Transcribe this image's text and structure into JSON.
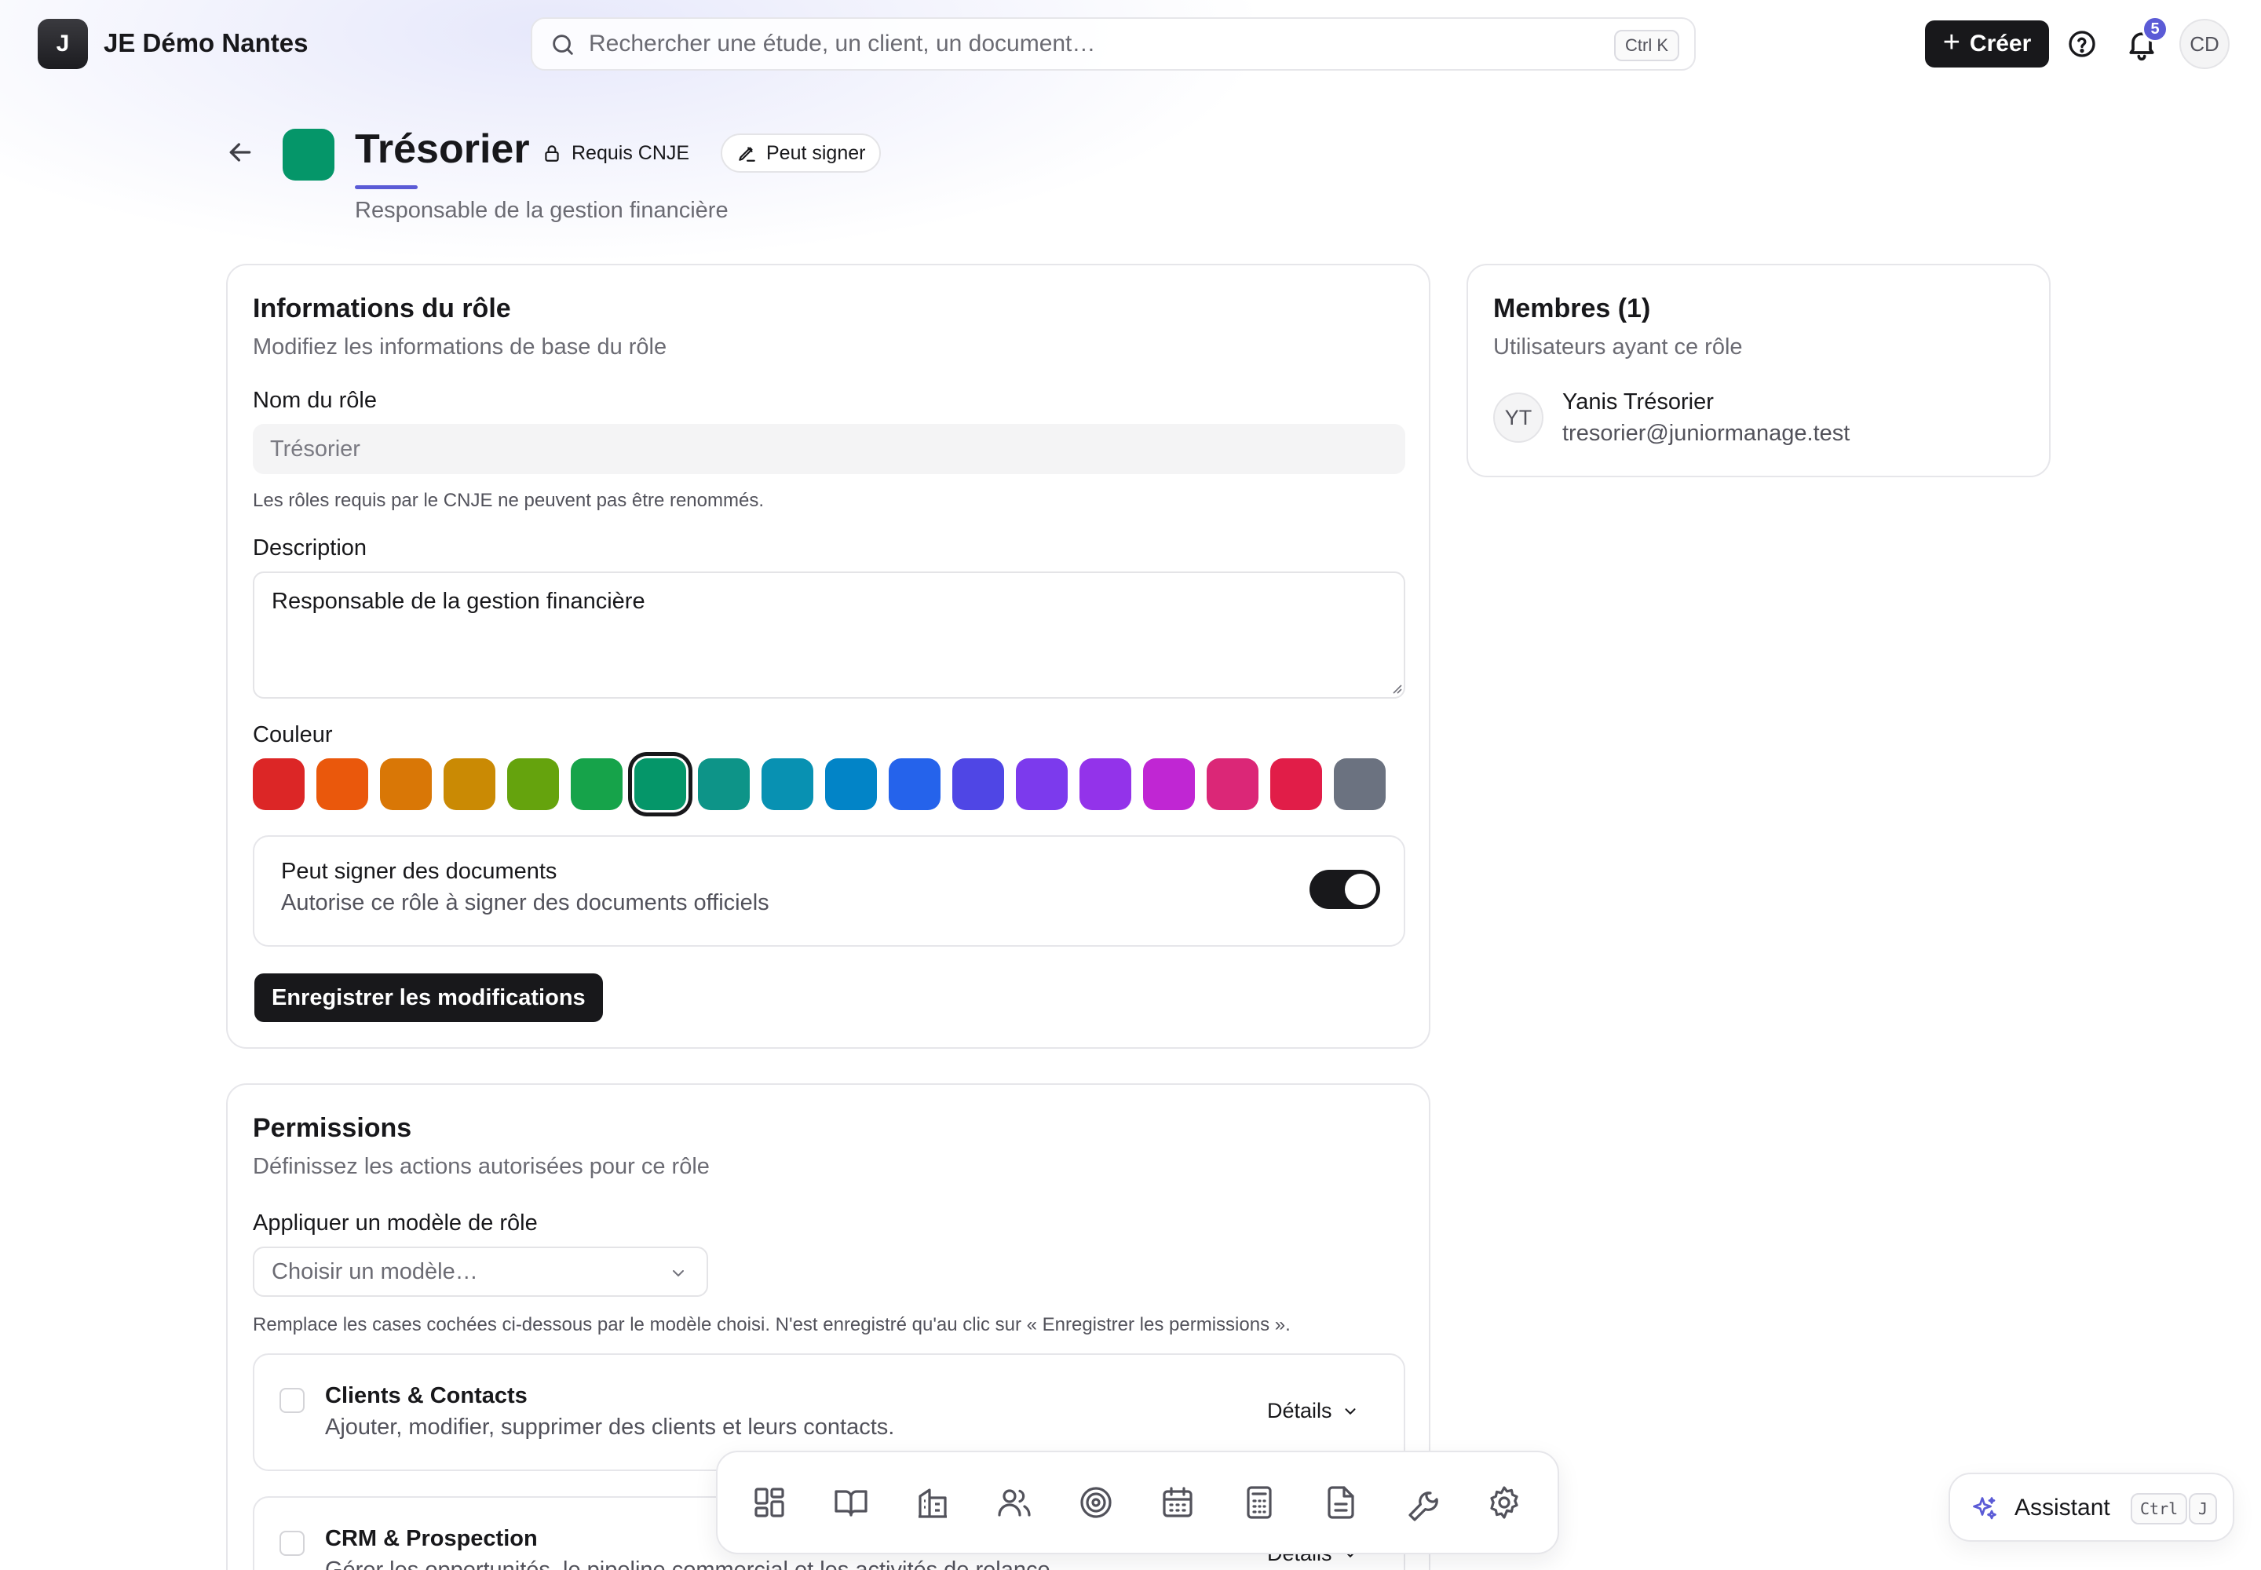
{
  "topbar": {
    "org_initial": "J",
    "org_name": "JE Démo Nantes",
    "search_placeholder": "Rechercher une étude, un client, un document…",
    "search_shortcut": "Ctrl K",
    "create_label": "Créer",
    "notifications_count": "5",
    "user_initials": "CD"
  },
  "header": {
    "title": "Trésorier",
    "subtitle": "Responsable de la gestion financière",
    "badge_required": "Requis CNJE",
    "badge_sign": "Peut signer",
    "role_color": "#059669"
  },
  "role_info": {
    "title": "Informations du rôle",
    "description": "Modifiez les informations de base du rôle",
    "name_label": "Nom du rôle",
    "name_value": "Trésorier",
    "name_help": "Les rôles requis par le CNJE ne peuvent pas être renommés.",
    "desc_label": "Description",
    "desc_value": "Responsable de la gestion financière",
    "color_label": "Couleur",
    "colors": [
      "#dc2626",
      "#ea580c",
      "#d97706",
      "#ca8a04",
      "#65a30d",
      "#16a34a",
      "#059669",
      "#0d9488",
      "#0891b2",
      "#0284c7",
      "#2563eb",
      "#4f46e5",
      "#7c3aed",
      "#9333ea",
      "#c026d3",
      "#db2777",
      "#e11d48",
      "#6b7280"
    ],
    "selected_color": "#059669",
    "sign_title": "Peut signer des documents",
    "sign_description": "Autorise ce rôle à signer des documents officiels",
    "sign_enabled": true,
    "save_label": "Enregistrer les modifications"
  },
  "permissions": {
    "title": "Permissions",
    "description": "Définissez les actions autorisées pour ce rôle",
    "template_label": "Appliquer un modèle de rôle",
    "template_placeholder": "Choisir un modèle…",
    "template_help": "Remplace les cases cochées ci-dessous par le modèle choisi. N'est enregistré qu'au clic sur « Enregistrer les permissions ».",
    "details_label": "Détails",
    "groups": [
      {
        "title": "Clients & Contacts",
        "description": "Ajouter, modifier, supprimer des clients et leurs contacts."
      },
      {
        "title": "CRM & Prospection",
        "description": "Gérer les opportunités, le pipeline commercial et les activités de relance."
      }
    ]
  },
  "members": {
    "title": "Membres (1)",
    "description": "Utilisateurs ayant ce rôle",
    "list": [
      {
        "initials": "YT",
        "name": "Yanis Trésorier",
        "email": "tresorier@juniormanage.test"
      }
    ]
  },
  "dock": {
    "items": [
      "dashboard-icon",
      "book-icon",
      "building-icon",
      "users-icon",
      "target-icon",
      "calendar-icon",
      "calculator-icon",
      "document-icon",
      "wrench-icon",
      "settings-icon"
    ]
  },
  "assistant": {
    "label": "Assistant",
    "shortcut_key1": "Ctrl",
    "shortcut_key2": "J"
  }
}
